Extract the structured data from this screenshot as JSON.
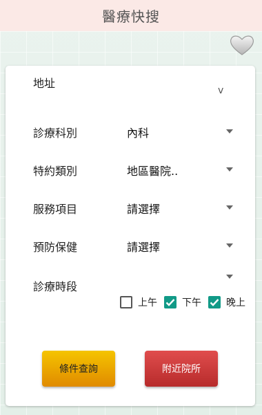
{
  "header": {
    "title": "醫療快搜"
  },
  "favorite": {
    "icon": "heart-icon"
  },
  "form": {
    "address": {
      "label": "地址",
      "caret": "v"
    },
    "rows": [
      {
        "label": "診療科別",
        "value": "內科"
      },
      {
        "label": "特約類別",
        "value": "地區醫院.."
      },
      {
        "label": "服務項目",
        "value": "請選擇"
      },
      {
        "label": "預防保健",
        "value": "請選擇"
      }
    ],
    "time_period": {
      "label": "診療時段",
      "options": [
        {
          "label": "上午",
          "checked": false
        },
        {
          "label": "下午",
          "checked": true
        },
        {
          "label": "晚上",
          "checked": true
        }
      ]
    }
  },
  "buttons": {
    "query": "條件查詢",
    "nearby": "附近院所"
  },
  "colors": {
    "checkbox_on": "#119a87",
    "query_btn": "#f0b000",
    "nearby_btn": "#c93838",
    "header_bg": "#fbe9e6"
  }
}
